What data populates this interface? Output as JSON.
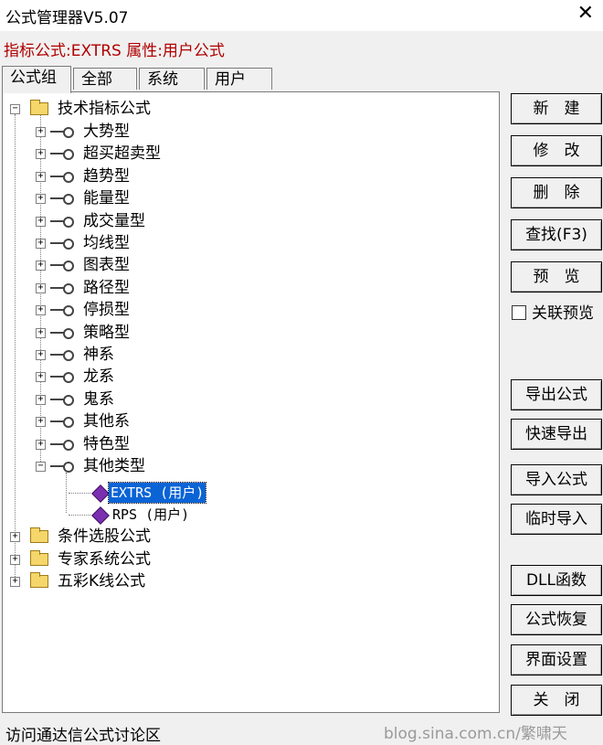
{
  "window": {
    "title": "公式管理器V5.07",
    "close_glyph": "✕"
  },
  "info_line": "指标公式:EXTRS 属性:用户公式",
  "tabs": [
    {
      "label": "公式组",
      "active": true
    },
    {
      "label": "全部",
      "active": false
    },
    {
      "label": "系统",
      "active": false
    },
    {
      "label": "用户",
      "active": false
    }
  ],
  "tree": {
    "root1": {
      "label": "技术指标公式",
      "expander": "−",
      "icon": "folder-icon"
    },
    "groups": [
      {
        "label": "大势型",
        "expander": "+"
      },
      {
        "label": "超买超卖型",
        "expander": "+"
      },
      {
        "label": "趋势型",
        "expander": "+"
      },
      {
        "label": "能量型",
        "expander": "+"
      },
      {
        "label": "成交量型",
        "expander": "+"
      },
      {
        "label": "均线型",
        "expander": "+"
      },
      {
        "label": "图表型",
        "expander": "+"
      },
      {
        "label": "路径型",
        "expander": "+"
      },
      {
        "label": "停损型",
        "expander": "+"
      },
      {
        "label": "策略型",
        "expander": "+"
      },
      {
        "label": "神系",
        "expander": "+"
      },
      {
        "label": "龙系",
        "expander": "+"
      },
      {
        "label": "鬼系",
        "expander": "+"
      },
      {
        "label": "其他系",
        "expander": "+"
      },
      {
        "label": "特色型",
        "expander": "+"
      },
      {
        "label": "其他类型",
        "expander": "−"
      }
    ],
    "formulas": [
      {
        "label": "EXTRS  (用户)",
        "selected": true
      },
      {
        "label": "RPS  (用户)",
        "selected": false
      }
    ],
    "roots": [
      {
        "label": "条件选股公式",
        "expander": "+"
      },
      {
        "label": "专家系统公式",
        "expander": "+"
      },
      {
        "label": "五彩K线公式",
        "expander": "+"
      }
    ]
  },
  "buttons": {
    "new": "新　建",
    "edit": "修　改",
    "delete": "删　除",
    "find": "查找(F3)",
    "preview": "预　览",
    "export": "导出公式",
    "quick_export": "快速导出",
    "import": "导入公式",
    "temp_import": "临时导入",
    "dll": "DLL函数",
    "restore": "公式恢复",
    "ui_settings": "界面设置",
    "close": "关　闭"
  },
  "link_preview": {
    "label": "关联预览",
    "checked": false
  },
  "status_text": "访问通达信公式讨论区",
  "watermark": "blog.sina.com.cn/繁啸天"
}
